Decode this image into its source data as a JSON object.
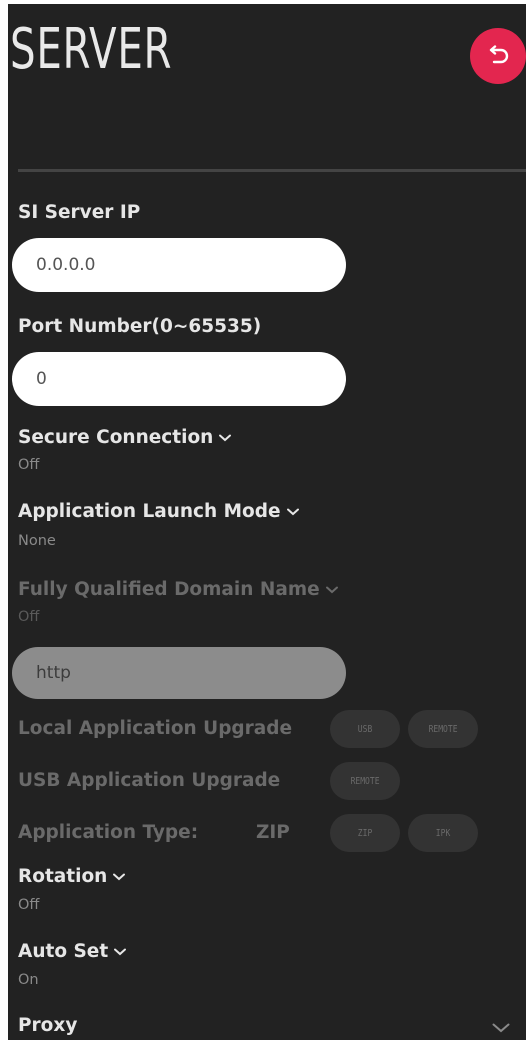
{
  "header": {
    "title": "SERVER",
    "back_icon": "back-arrow-icon",
    "back_color": "#e3264f"
  },
  "si_server_ip": {
    "label": "SI Server IP",
    "value": "0.0.0.0"
  },
  "port_number": {
    "label": "Port Number(0~65535)",
    "value": "0"
  },
  "secure_connection": {
    "label": "Secure Connection",
    "value": "Off"
  },
  "app_launch_mode": {
    "label": "Application Launch Mode",
    "value": "None"
  },
  "fqdn": {
    "label": "Fully Qualified Domain Name",
    "value": "Off",
    "field_value": "http"
  },
  "local_app_upgrade": {
    "label": "Local Application Upgrade",
    "buttons": [
      "USB",
      "REMOTE"
    ]
  },
  "usb_app_upgrade": {
    "label": "USB Application Upgrade",
    "buttons": [
      "REMOTE"
    ]
  },
  "application_type": {
    "label": "Application Type:",
    "value": "ZIP",
    "buttons": [
      "ZIP",
      "IPK"
    ]
  },
  "rotation": {
    "label": "Rotation",
    "value": "Off"
  },
  "auto_set": {
    "label": "Auto Set",
    "value": "On"
  },
  "proxy": {
    "label": "Proxy"
  }
}
